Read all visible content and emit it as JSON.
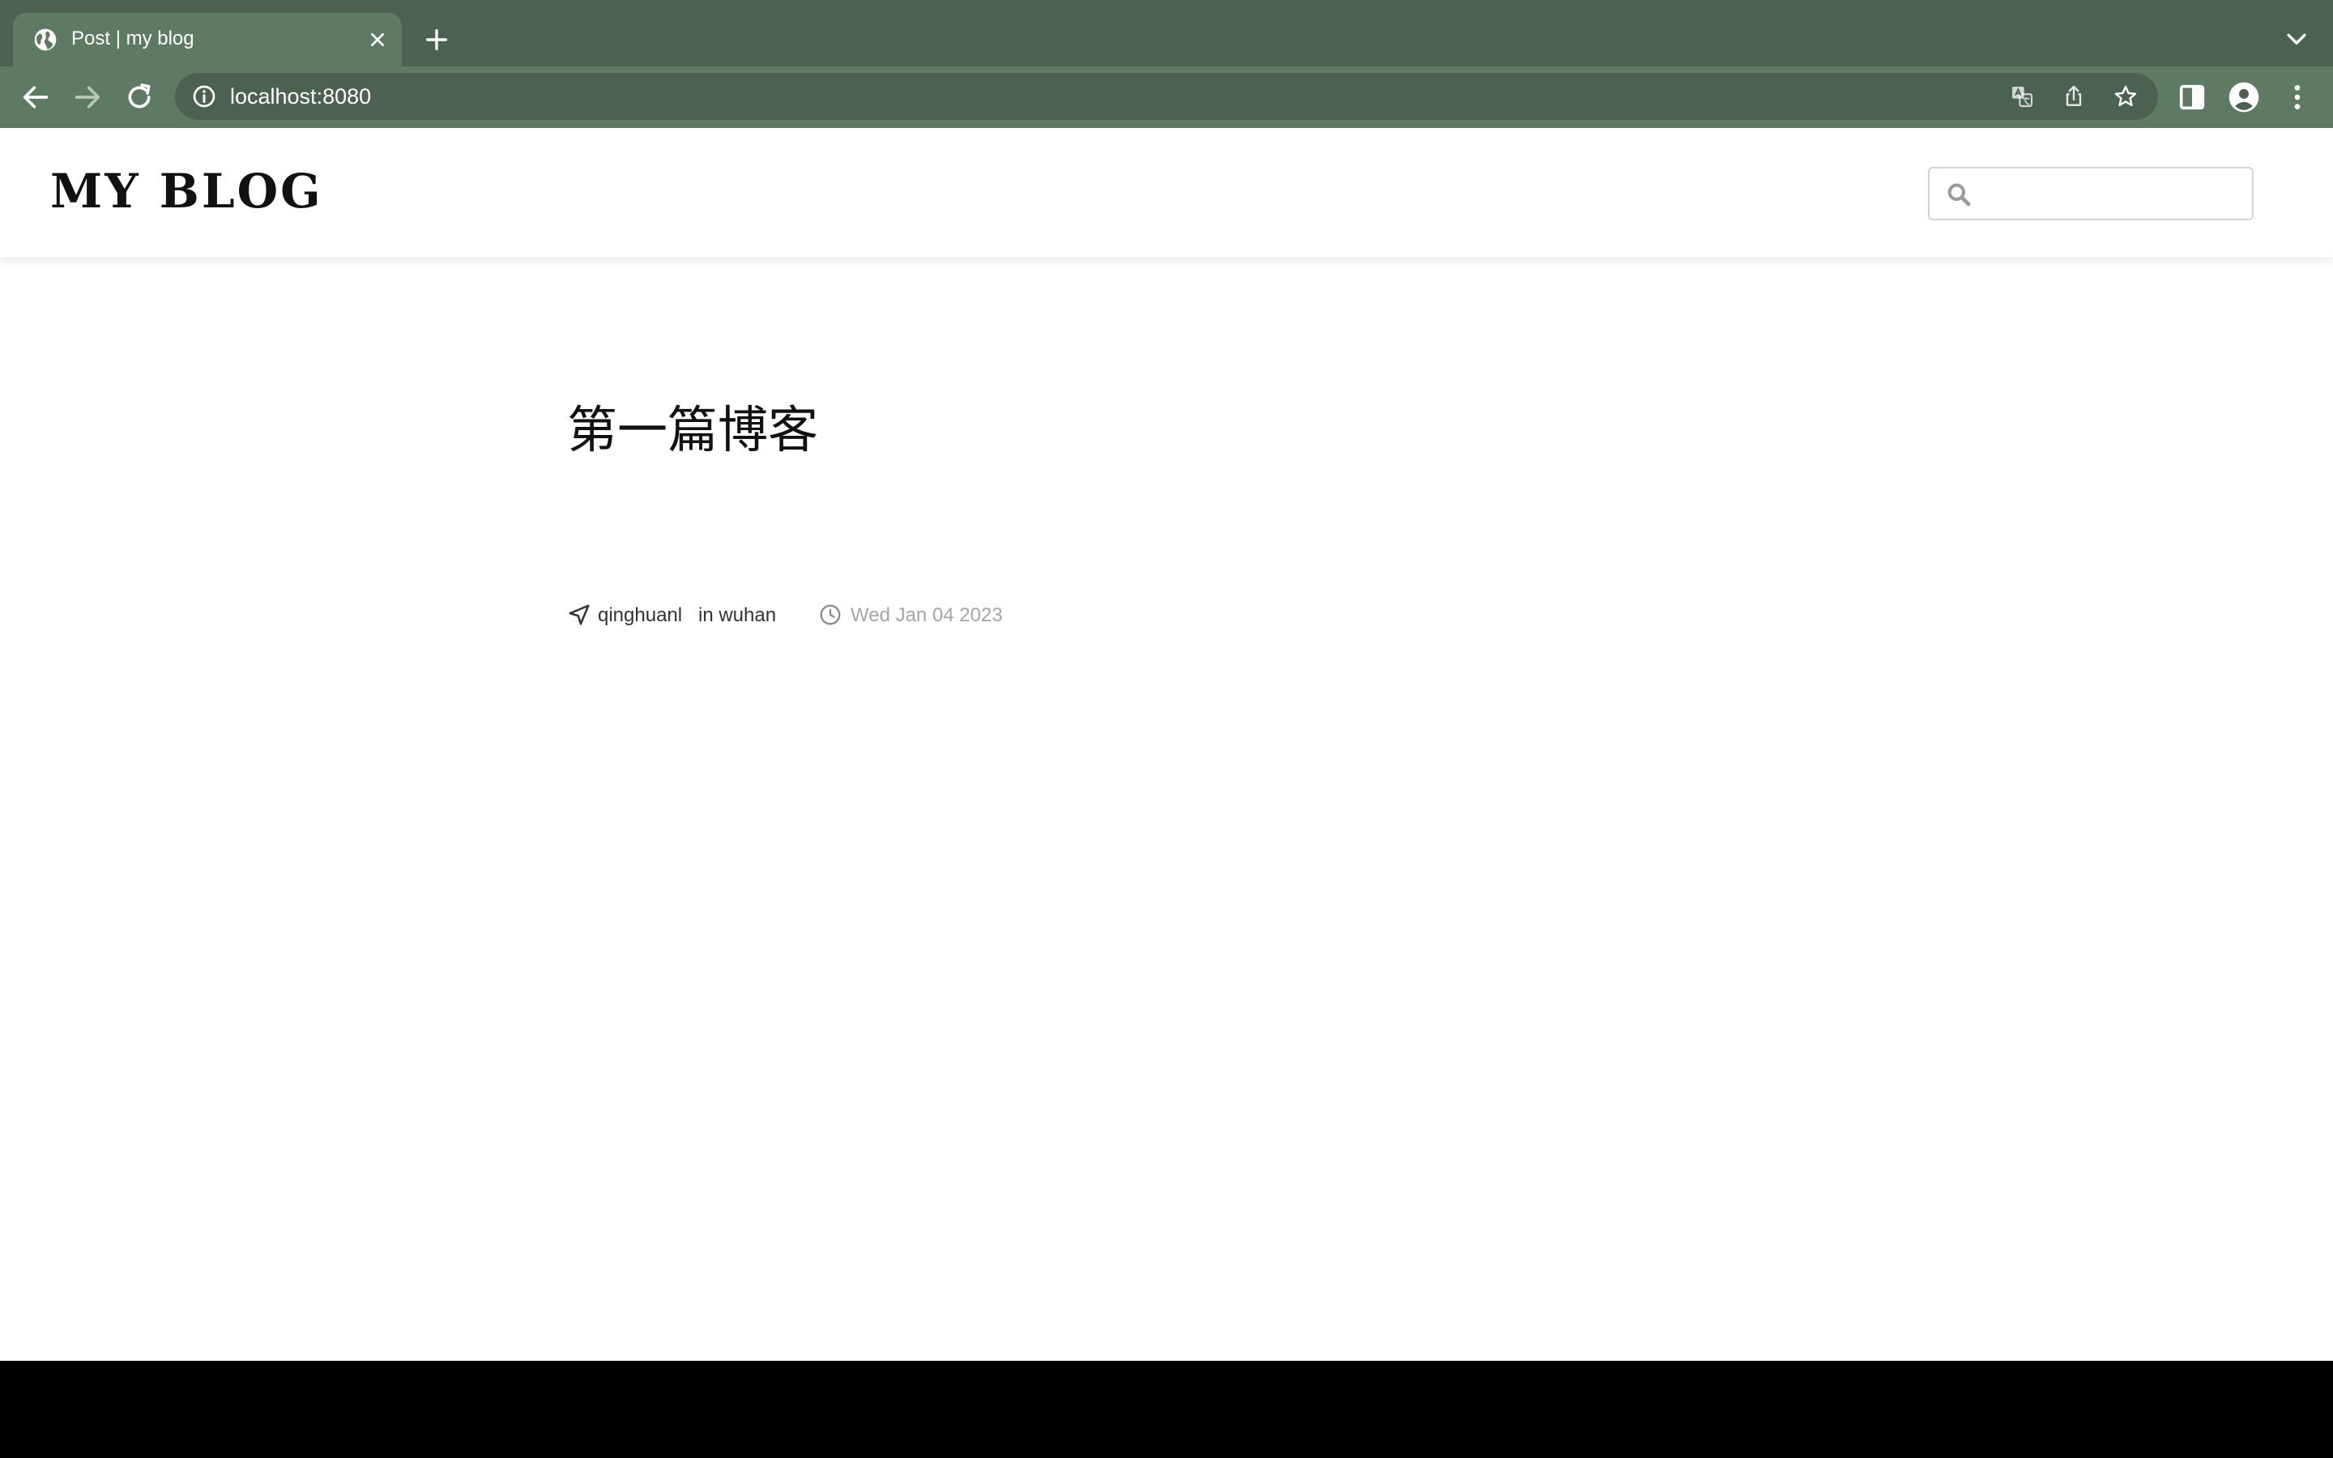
{
  "browser": {
    "tab": {
      "title": "Post | my blog",
      "favicon": "globe-icon"
    },
    "address_bar": {
      "url": "localhost:8080"
    },
    "icons": [
      "back-icon",
      "forward-icon",
      "reload-icon",
      "site-info-icon",
      "translate-icon",
      "share-icon",
      "bookmark-star-icon",
      "side-panel-icon",
      "profile-icon",
      "menu-icon",
      "tab-close-icon",
      "new-tab-icon",
      "tab-list-icon"
    ]
  },
  "header": {
    "logo": "MY BLOG",
    "search": {
      "placeholder": "",
      "value": ""
    }
  },
  "post": {
    "title": "第一篇博客",
    "author": "qinghuanl",
    "location": "in wuhan",
    "date": "Wed Jan 04 2023"
  },
  "colors": {
    "chrome_dark": "#4d6151",
    "chrome_light": "#5f7a63",
    "page_bg": "#ffffff",
    "meta_date": "#9e9e9e",
    "footer": "#000000"
  }
}
